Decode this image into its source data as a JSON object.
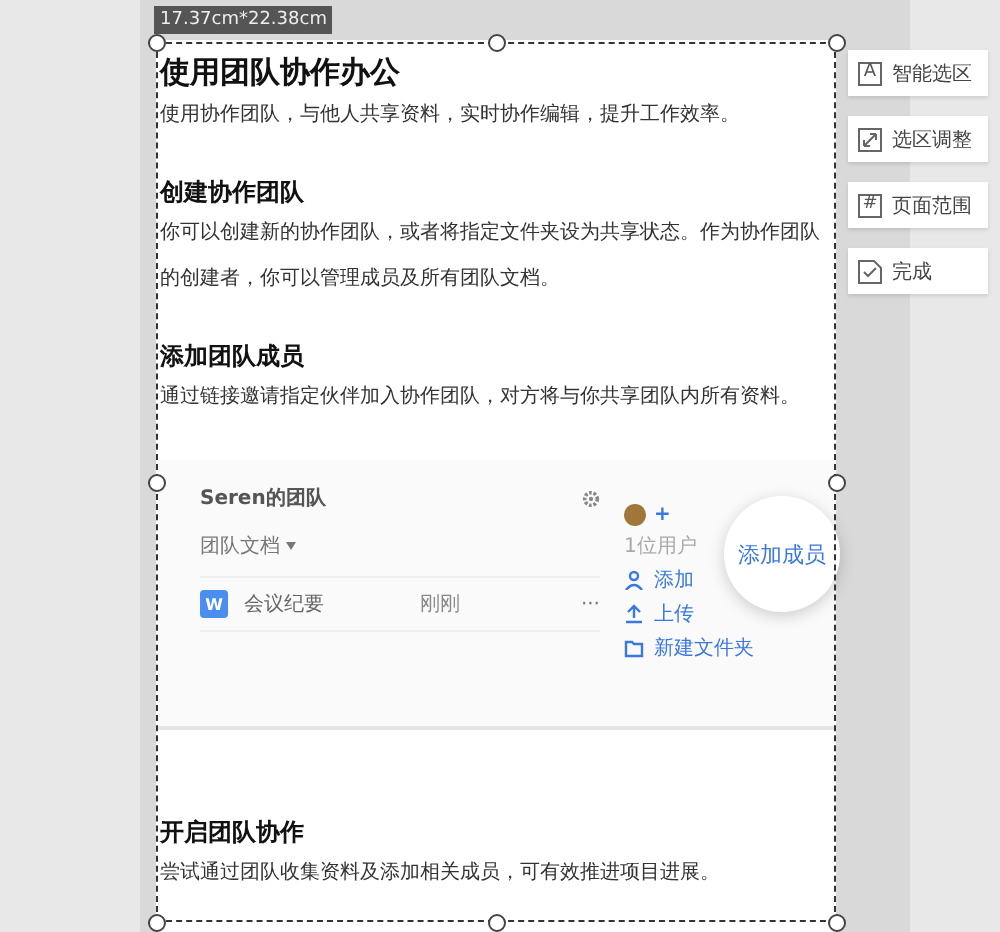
{
  "size_label": "17.37cm*22.38cm",
  "blocks": [
    {
      "kind": "title",
      "text": "使用团队协作办公"
    },
    {
      "kind": "paragraph",
      "text": "使用协作团队，与他人共享资料，实时协作编辑，提升工作效率。"
    },
    {
      "kind": "heading",
      "text": "创建协作团队"
    },
    {
      "kind": "paragraph",
      "text": "你可以创建新的协作团队，或者将指定文件夹设为共享状态。作为协作团队的创建者，你可以管理成员及所有团队文档。"
    },
    {
      "kind": "heading",
      "text": "添加团队成员"
    },
    {
      "kind": "paragraph",
      "text": "通过链接邀请指定伙伴加入协作团队，对方将与你共享团队内所有资料。"
    },
    {
      "kind": "screenshot",
      "team_name": "Seren的团队",
      "folder_label": "团队文档",
      "files": [
        {
          "badge": "W",
          "name": "会议纪要",
          "time": "刚刚",
          "more": "···"
        }
      ],
      "add_symbol": "+",
      "member_count": "1位用户",
      "actions": [
        {
          "kind": "person",
          "label": "添加"
        },
        {
          "kind": "upload",
          "label": "上传"
        },
        {
          "kind": "folder",
          "label": "新建文件夹"
        }
      ],
      "callout": "添加成员"
    },
    {
      "kind": "heading",
      "text": "开启团队协作"
    },
    {
      "kind": "paragraph",
      "text": "尝试通过团队收集资料及添加相关成员，可有效推进项目进展。"
    }
  ],
  "toolbar": [
    {
      "kind": "letter",
      "glyph": "A",
      "label": "智能选区"
    },
    {
      "kind": "resize",
      "label": "选区调整"
    },
    {
      "kind": "letter",
      "glyph": "#",
      "label": "页面范围"
    },
    {
      "kind": "check",
      "label": "完成"
    }
  ]
}
